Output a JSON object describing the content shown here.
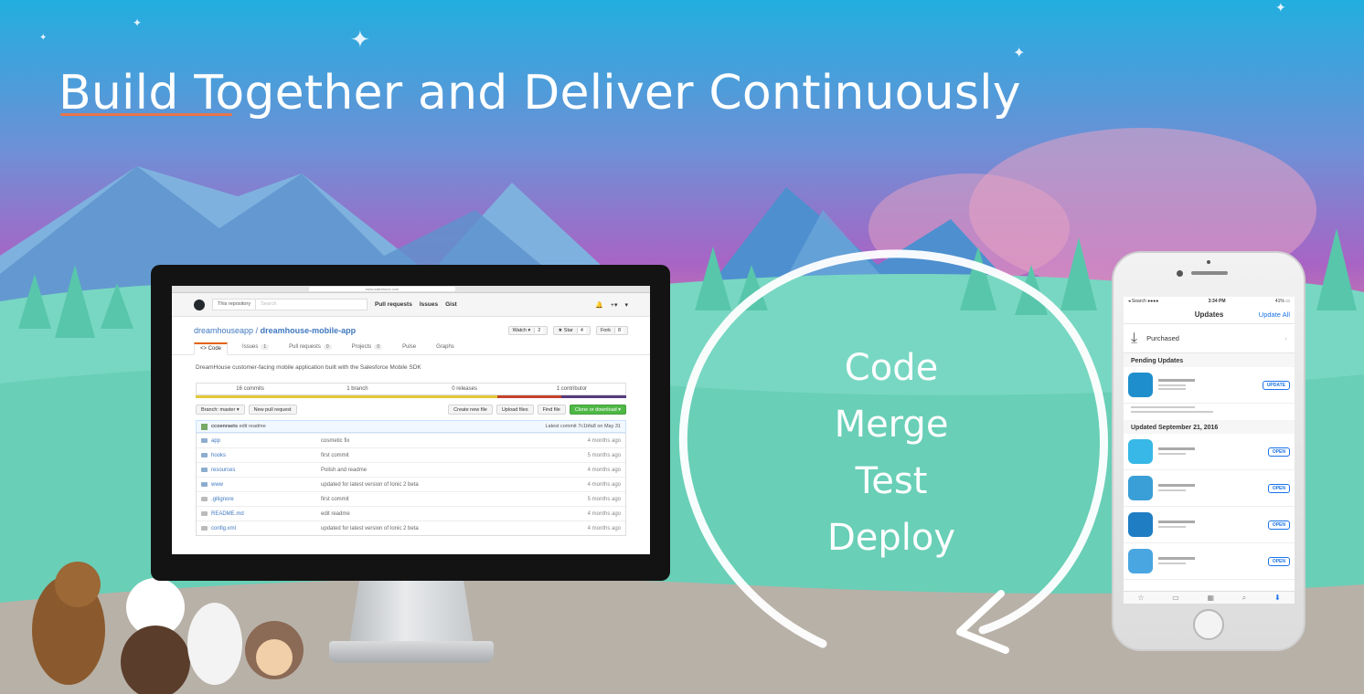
{
  "slide": {
    "title": "Build Together and Deliver Continuously",
    "cycle_steps": [
      "Code",
      "Merge",
      "Test",
      "Deploy"
    ],
    "colors": {
      "accent_underline": "#e8744a",
      "sky_top": "#2bb0dc",
      "sky_mid": "#9b5fc0",
      "sunset": "#f3a35a",
      "hills": "#6fd2bc"
    }
  },
  "browser": {
    "url": "www.salesforce.com"
  },
  "github": {
    "header": {
      "search_scope": "This repository",
      "search_placeholder": "Search",
      "nav": [
        "Pull requests",
        "Issues",
        "Gist"
      ],
      "right_icons": [
        "bell-icon",
        "plus-icon",
        "user-icon"
      ],
      "right_glyphs": [
        "🔔",
        "+▾",
        "▾"
      ]
    },
    "repo": {
      "owner": "dreamhouseapp",
      "separator": "/",
      "name": "dreamhouse-mobile-app",
      "buttons": [
        {
          "label": "Watch ▾",
          "count": "2"
        },
        {
          "label": "★ Star",
          "count": "4"
        },
        {
          "label": "Fork",
          "count": "8"
        }
      ]
    },
    "tabs": [
      {
        "label": "<> Code",
        "count": ""
      },
      {
        "label": "Issues",
        "count": "1"
      },
      {
        "label": "Pull requests",
        "count": "0"
      },
      {
        "label": "Projects",
        "count": "0"
      },
      {
        "label": "Pulse",
        "count": ""
      },
      {
        "label": "Graphs",
        "count": ""
      }
    ],
    "description": "DreamHouse customer-facing mobile application built with the Salesforce Mobile SDK",
    "stats": {
      "commits": "16 commits",
      "branches": "1 branch",
      "releases": "0 releases",
      "contributors": "1 contributor"
    },
    "language_colors": [
      "#e3c838",
      "#c3432b",
      "#563d7c"
    ],
    "actions": {
      "branch": "Branch: master ▾",
      "new_pr": "New pull request",
      "create_file": "Create new file",
      "upload_files": "Upload files",
      "find_file": "Find file",
      "clone": "Clone or download ▾"
    },
    "latest_commit": {
      "author": "ccoenraets",
      "message": "edit readme",
      "info": "Latest commit 7c1bfa8 on May 31"
    },
    "files": [
      {
        "name": "app",
        "message": "cosmetic fix",
        "age": "4 months ago",
        "type": "dir"
      },
      {
        "name": "hooks",
        "message": "first commit",
        "age": "5 months ago",
        "type": "dir"
      },
      {
        "name": "resources",
        "message": "Polish and readme",
        "age": "4 months ago",
        "type": "dir"
      },
      {
        "name": "www",
        "message": "updated for latest version of Ionic 2 beta",
        "age": "4 months ago",
        "type": "dir"
      },
      {
        "name": ".gitignore",
        "message": "first commit",
        "age": "5 months ago",
        "type": "file"
      },
      {
        "name": "README.md",
        "message": "edit readme",
        "age": "4 months ago",
        "type": "file"
      },
      {
        "name": "config.xml",
        "message": "updated for latest version of Ionic 2 beta",
        "age": "4 months ago",
        "type": "file"
      }
    ]
  },
  "phone": {
    "status": {
      "carrier": "◂ Search ●●●● ",
      "time": "3:34 PM",
      "battery": "41% ▭"
    },
    "nav": {
      "title": "Updates",
      "action": "Update All"
    },
    "purchased": "Purchased",
    "purchased_icon": "download-arrow-icon",
    "pending_title": "Pending Updates",
    "pending_app_button": "UPDATE",
    "updated_title": "Updated September 21, 2016",
    "updated_app_button": "OPEN",
    "updated_app_colors": [
      "#37b8e6",
      "#3a9fd6",
      "#1f7dc4",
      "#4aa6e0"
    ],
    "tabbar_icons": [
      "☆",
      "▭",
      "▦",
      "⌕",
      "⬇"
    ]
  }
}
